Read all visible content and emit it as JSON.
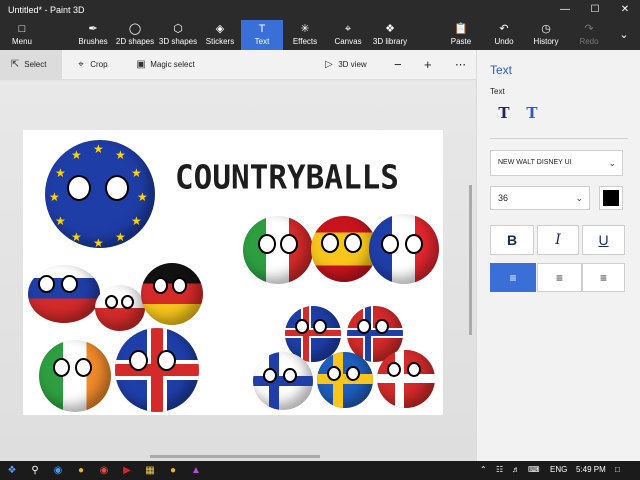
{
  "window": {
    "title": "Untitled* - Paint 3D"
  },
  "ribbon": {
    "menu": "Menu",
    "tools": [
      {
        "label": "Brushes",
        "icon": "brush-icon"
      },
      {
        "label": "2D shapes",
        "icon": "2d-shapes-icon"
      },
      {
        "label": "3D shapes",
        "icon": "3d-shapes-icon"
      },
      {
        "label": "Stickers",
        "icon": "stickers-icon"
      },
      {
        "label": "Text",
        "icon": "text-icon"
      },
      {
        "label": "Effects",
        "icon": "effects-icon"
      },
      {
        "label": "Canvas",
        "icon": "canvas-icon"
      },
      {
        "label": "3D library",
        "icon": "3d-library-icon"
      }
    ],
    "paste": "Paste",
    "undo": "Undo",
    "history": "History",
    "redo": "Redo",
    "active_tool": "Text"
  },
  "toolbar": {
    "select": "Select",
    "crop": "Crop",
    "magic_select": "Magic select",
    "view_3d": "3D view"
  },
  "canvas": {
    "headline": "COUNTRYBALLS"
  },
  "panel": {
    "title": "Text",
    "subtitle": "Text",
    "font": "NEW WALT DISNEY UI",
    "size": "36",
    "color": "#000000",
    "bold": "B",
    "italic": "I",
    "underline": "U"
  },
  "taskbar": {
    "language": "ENG",
    "time": "5:49 PM"
  },
  "colors": {
    "accent": "#3a6fd8",
    "ribbon_bg": "#2b2b2b",
    "panel_title": "#2a5bd7"
  }
}
